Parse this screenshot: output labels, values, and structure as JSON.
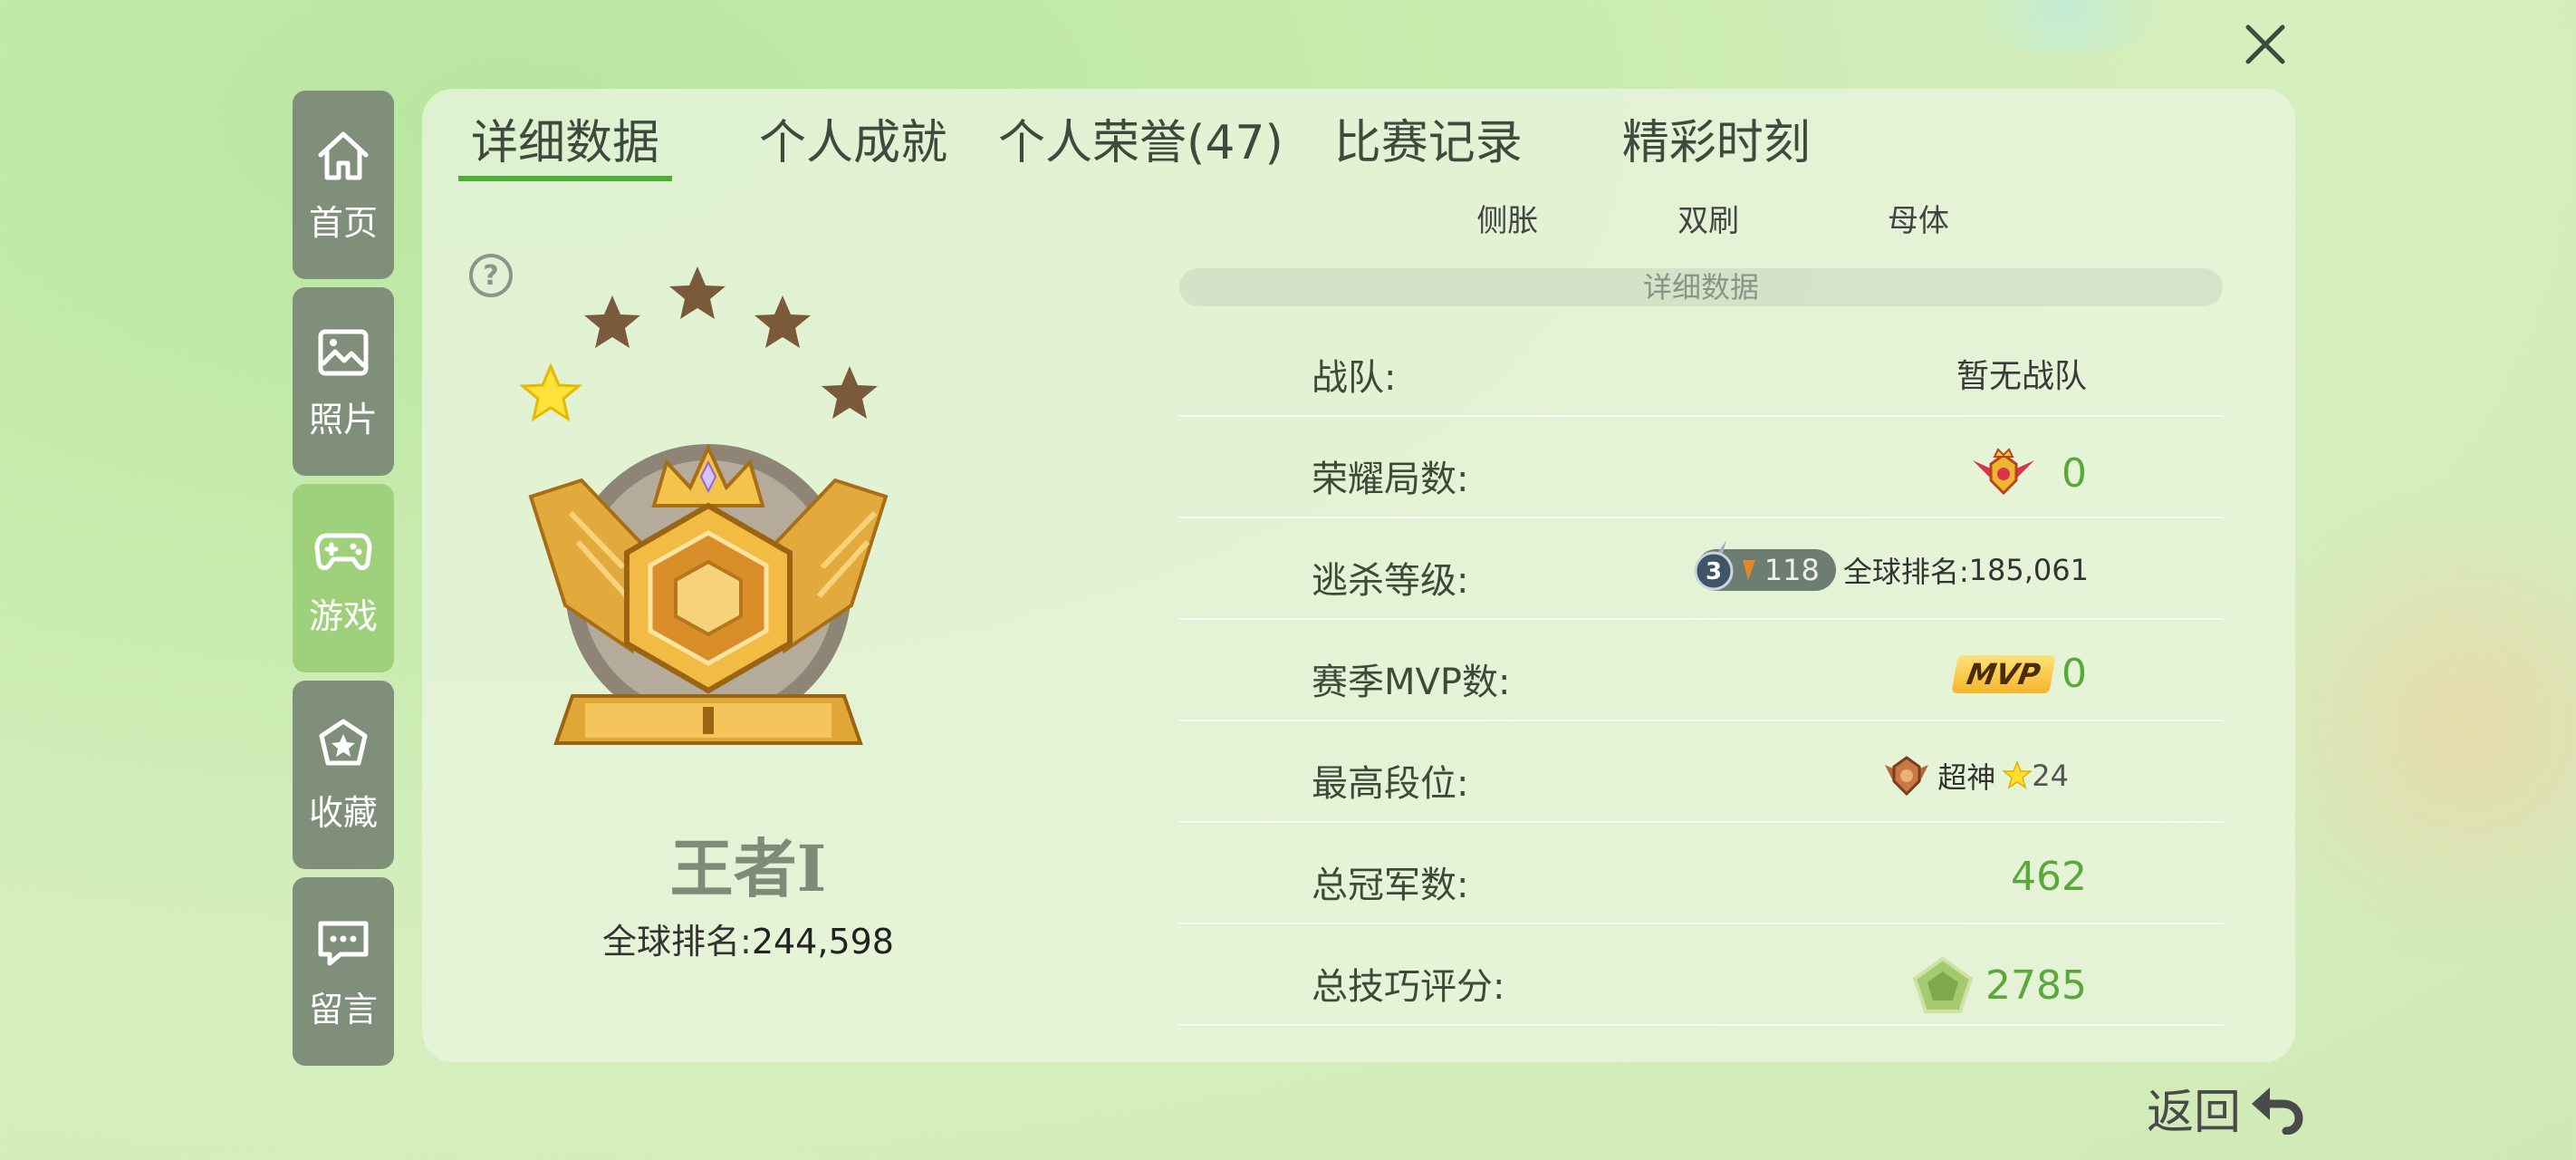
{
  "colors": {
    "accent": "#4fae3a",
    "value_green": "#5aa83a",
    "sidebar_active": "#9fd07c",
    "sidebar_inactive": "#7f8f7a",
    "gold": "#e8b54a"
  },
  "sidebar": {
    "items": [
      {
        "label": "首页",
        "icon": "home-icon",
        "active": false
      },
      {
        "label": "照片",
        "icon": "image-icon",
        "active": false
      },
      {
        "label": "游戏",
        "icon": "gamepad-icon",
        "active": true
      },
      {
        "label": "收藏",
        "icon": "star-icon",
        "active": false
      },
      {
        "label": "留言",
        "icon": "message-icon",
        "active": false
      }
    ]
  },
  "tabs": [
    {
      "label": "详细数据",
      "active": true
    },
    {
      "label": "个人成就",
      "active": false
    },
    {
      "label": "个人荣誉(47)",
      "active": false
    },
    {
      "label": "比赛记录",
      "active": false
    },
    {
      "label": "精彩时刻",
      "active": false
    }
  ],
  "modes": [
    "侧胀",
    "双刷",
    "母体"
  ],
  "rank": {
    "name": "王者I",
    "stars_filled": 1,
    "stars_total": 5,
    "global_rank_label": "全球排名:",
    "global_rank_value": "244,598"
  },
  "section_title": "详细数据",
  "stats": {
    "team": {
      "label": "战队:",
      "value": "暂无战队"
    },
    "glory": {
      "label": "荣耀局数:",
      "value": "0"
    },
    "escape": {
      "label": "逃杀等级:",
      "badge": "3",
      "level": "118",
      "rank_label": "全球排名:",
      "rank_value": "185,061"
    },
    "mvp": {
      "label": "赛季MVP数:",
      "badge": "MVP",
      "value": "0"
    },
    "highest": {
      "label": "最高段位:",
      "tier": "超神",
      "stars": "24"
    },
    "champion": {
      "label": "总冠军数:",
      "value": "462"
    },
    "skill": {
      "label": "总技巧评分:",
      "value": "2785"
    }
  },
  "back_label": "返回"
}
